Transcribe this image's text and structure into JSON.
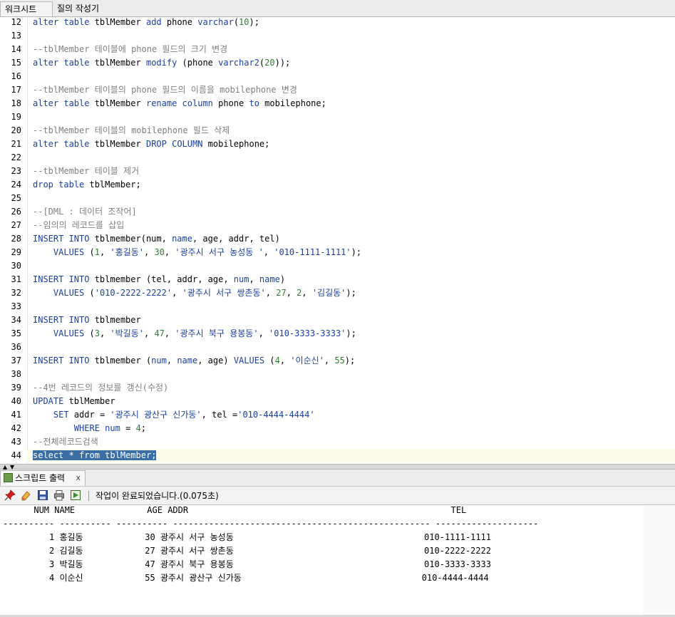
{
  "tabs": {
    "worksheet": "워크시트",
    "query_builder": "질의 작성기"
  },
  "editor": {
    "lines": [
      {
        "n": "12",
        "segs": [
          {
            "t": "alter table",
            "c": "kw"
          },
          {
            "t": " tblMember "
          },
          {
            "t": "add",
            "c": "kw"
          },
          {
            "t": " phone "
          },
          {
            "t": "varchar",
            "c": "kw"
          },
          {
            "t": "("
          },
          {
            "t": "10",
            "c": "num"
          },
          {
            "t": ");"
          }
        ]
      },
      {
        "n": "13",
        "segs": []
      },
      {
        "n": "14",
        "segs": [
          {
            "t": "--tblMember 테이블에 phone 필드의 크기 변경",
            "c": "cm"
          }
        ]
      },
      {
        "n": "15",
        "segs": [
          {
            "t": "alter table",
            "c": "kw"
          },
          {
            "t": " tblMember "
          },
          {
            "t": "modify",
            "c": "kw"
          },
          {
            "t": " (phone "
          },
          {
            "t": "varchar2",
            "c": "kw"
          },
          {
            "t": "("
          },
          {
            "t": "20",
            "c": "num"
          },
          {
            "t": "));"
          }
        ]
      },
      {
        "n": "16",
        "segs": []
      },
      {
        "n": "17",
        "segs": [
          {
            "t": "--tblMember 테이블의 phone 필드의 이름을 mobilephone 변경",
            "c": "cm"
          }
        ]
      },
      {
        "n": "18",
        "segs": [
          {
            "t": "alter table",
            "c": "kw"
          },
          {
            "t": " tblMember "
          },
          {
            "t": "rename column",
            "c": "kw"
          },
          {
            "t": " phone "
          },
          {
            "t": "to",
            "c": "kw"
          },
          {
            "t": " mobilephone;"
          }
        ]
      },
      {
        "n": "19",
        "segs": []
      },
      {
        "n": "20",
        "segs": [
          {
            "t": "--tblMember 테이블의 mobilephone 필드 삭제",
            "c": "cm"
          }
        ]
      },
      {
        "n": "21",
        "segs": [
          {
            "t": "alter table",
            "c": "kw"
          },
          {
            "t": " tblMember "
          },
          {
            "t": "DROP COLUMN",
            "c": "kw"
          },
          {
            "t": " mobilephone;"
          }
        ]
      },
      {
        "n": "22",
        "segs": []
      },
      {
        "n": "23",
        "segs": [
          {
            "t": "--tblMember 테이블 제거",
            "c": "cm"
          }
        ]
      },
      {
        "n": "24",
        "segs": [
          {
            "t": "drop table",
            "c": "kw"
          },
          {
            "t": " tblMember;"
          }
        ]
      },
      {
        "n": "25",
        "segs": []
      },
      {
        "n": "26",
        "segs": [
          {
            "t": "--[DML : 데이터 조작어]",
            "c": "cm"
          }
        ]
      },
      {
        "n": "27",
        "segs": [
          {
            "t": "--임의의 레코드를 삽입",
            "c": "cm"
          }
        ]
      },
      {
        "n": "28",
        "segs": [
          {
            "t": "INSERT INTO",
            "c": "kw"
          },
          {
            "t": " tblmember(num, "
          },
          {
            "t": "name",
            "c": "kw"
          },
          {
            "t": ", age, addr, tel)"
          }
        ]
      },
      {
        "n": "29",
        "segs": [
          {
            "t": "    "
          },
          {
            "t": "VALUES",
            "c": "kw"
          },
          {
            "t": " ("
          },
          {
            "t": "1",
            "c": "num"
          },
          {
            "t": ", "
          },
          {
            "t": "'홍길동'",
            "c": "str"
          },
          {
            "t": ", "
          },
          {
            "t": "30",
            "c": "num"
          },
          {
            "t": ", "
          },
          {
            "t": "'광주시 서구 농성동 '",
            "c": "str"
          },
          {
            "t": ", "
          },
          {
            "t": "'010-1111-1111'",
            "c": "str"
          },
          {
            "t": ");"
          }
        ]
      },
      {
        "n": "30",
        "segs": []
      },
      {
        "n": "31",
        "segs": [
          {
            "t": "INSERT INTO",
            "c": "kw"
          },
          {
            "t": " tblmember (tel, addr, age, "
          },
          {
            "t": "num",
            "c": "kw"
          },
          {
            "t": ", "
          },
          {
            "t": "name",
            "c": "kw"
          },
          {
            "t": ")"
          }
        ]
      },
      {
        "n": "32",
        "segs": [
          {
            "t": "    "
          },
          {
            "t": "VALUES",
            "c": "kw"
          },
          {
            "t": " ("
          },
          {
            "t": "'010-2222-2222'",
            "c": "str"
          },
          {
            "t": ", "
          },
          {
            "t": "'광주시 서구 쌍촌동'",
            "c": "str"
          },
          {
            "t": ", "
          },
          {
            "t": "27",
            "c": "num"
          },
          {
            "t": ", "
          },
          {
            "t": "2",
            "c": "num"
          },
          {
            "t": ", "
          },
          {
            "t": "'김길동'",
            "c": "str"
          },
          {
            "t": ");"
          }
        ]
      },
      {
        "n": "33",
        "segs": []
      },
      {
        "n": "34",
        "segs": [
          {
            "t": "INSERT INTO",
            "c": "kw"
          },
          {
            "t": " tblmember"
          }
        ]
      },
      {
        "n": "35",
        "segs": [
          {
            "t": "    "
          },
          {
            "t": "VALUES",
            "c": "kw"
          },
          {
            "t": " ("
          },
          {
            "t": "3",
            "c": "num"
          },
          {
            "t": ", "
          },
          {
            "t": "'박길동'",
            "c": "str"
          },
          {
            "t": ", "
          },
          {
            "t": "47",
            "c": "num"
          },
          {
            "t": ", "
          },
          {
            "t": "'광주시 북구 용봉동'",
            "c": "str"
          },
          {
            "t": ", "
          },
          {
            "t": "'010-3333-3333'",
            "c": "str"
          },
          {
            "t": ");"
          }
        ]
      },
      {
        "n": "36",
        "segs": []
      },
      {
        "n": "37",
        "segs": [
          {
            "t": "INSERT INTO",
            "c": "kw"
          },
          {
            "t": " tblmember ("
          },
          {
            "t": "num",
            "c": "kw"
          },
          {
            "t": ", "
          },
          {
            "t": "name",
            "c": "kw"
          },
          {
            "t": ", age) "
          },
          {
            "t": "VALUES",
            "c": "kw"
          },
          {
            "t": " ("
          },
          {
            "t": "4",
            "c": "num"
          },
          {
            "t": ", "
          },
          {
            "t": "'이순신'",
            "c": "str"
          },
          {
            "t": ", "
          },
          {
            "t": "55",
            "c": "num"
          },
          {
            "t": ");"
          }
        ]
      },
      {
        "n": "38",
        "segs": []
      },
      {
        "n": "39",
        "segs": [
          {
            "t": "--4번 레코드의 정보를 갱신(수정)",
            "c": "cm"
          }
        ]
      },
      {
        "n": "40",
        "segs": [
          {
            "t": "UPDATE",
            "c": "kw"
          },
          {
            "t": " tblMember"
          }
        ]
      },
      {
        "n": "41",
        "segs": [
          {
            "t": "    "
          },
          {
            "t": "SET",
            "c": "kw"
          },
          {
            "t": " addr = "
          },
          {
            "t": "'광주시 광산구 신가동'",
            "c": "str"
          },
          {
            "t": ", tel ="
          },
          {
            "t": "'010-4444-4444'",
            "c": "str"
          }
        ]
      },
      {
        "n": "42",
        "segs": [
          {
            "t": "        "
          },
          {
            "t": "WHERE",
            "c": "kw"
          },
          {
            "t": " "
          },
          {
            "t": "num",
            "c": "kw"
          },
          {
            "t": " = "
          },
          {
            "t": "4",
            "c": "num"
          },
          {
            "t": ";"
          }
        ]
      },
      {
        "n": "43",
        "segs": [
          {
            "t": "--전체레코드검색",
            "c": "cm"
          }
        ]
      },
      {
        "n": "44",
        "sel": true,
        "segs": [
          {
            "t": "select",
            "c": "kw"
          },
          {
            "t": " * "
          },
          {
            "t": "from",
            "c": "kw"
          },
          {
            "t": " tblMember;"
          }
        ]
      }
    ]
  },
  "output": {
    "tab_label": "스크립트 출력",
    "close_glyph": "x",
    "status": "작업이 완료되었습니다.(0.075초)",
    "lines": [
      "      NUM NAME              AGE ADDR                                                   TEL",
      "---------- ---------- ---------- -------------------------------------------------- --------------------",
      "         1 홍길동            30 광주시 서구 농성동                                     010-1111-1111",
      "         2 김길동            27 광주시 서구 쌍촌동                                     010-2222-2222",
      "         3 박길동            47 광주시 북구 용봉동                                     010-3333-3333",
      "         4 이순신            55 광주시 광산구 신가동                                   010-4444-4444"
    ]
  },
  "icons": {
    "pin": "pin-icon",
    "eraser": "eraser-icon",
    "save": "save-icon",
    "print": "print-icon",
    "run": "run-script-icon",
    "output": "script-output-icon"
  },
  "colors": {
    "keyword": "#1a3fa0",
    "comment": "#7f7f7f",
    "number": "#2e7d32",
    "selection": "#3a6ea5"
  }
}
